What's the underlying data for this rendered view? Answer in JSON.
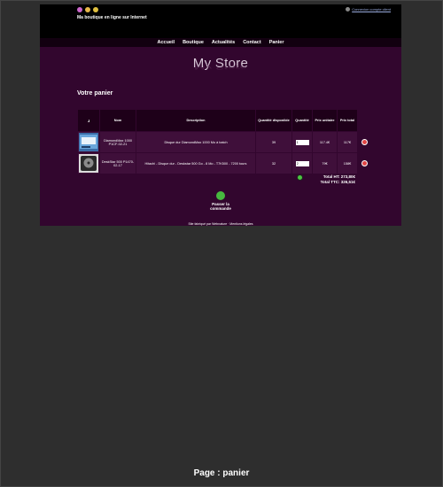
{
  "header": {
    "tagline": "Ma boutique en ligne sur Internet",
    "login_link": "Connexion compte client",
    "flags": [
      "#cc66cc",
      "#e8b84a",
      "#e0c040"
    ]
  },
  "nav": [
    "Accueil",
    "Boutique",
    "Actualités",
    "Contact",
    "Panier"
  ],
  "logo": "My Store",
  "cart": {
    "title": "Votre panier",
    "columns": [
      "Nom",
      "Description",
      "Quantité disponible",
      "Quantité",
      "Prix unitaire",
      "Prix total"
    ],
    "rows": [
      {
        "name": "DiamondMax 1000 P1CF-02-21",
        "description": "Disque dur DiamondMax 1000 Mo à batch",
        "stock": "39",
        "qty": "1",
        "unit_price": "117.4€",
        "total": "117€"
      },
      {
        "name": "DeskStar 500 P1470-02-17",
        "description": "Hitachi - Disque dur - Deskstar 500 Go - 8 Mo - T7K500 - 7200 tours",
        "stock": "32",
        "qty": "2",
        "unit_price": "79€",
        "total": "158€"
      }
    ],
    "total_ht": "Total HT: 273,80€",
    "total_ttc": "Total TTC: 326,51€",
    "order_label": "Passer la commande"
  },
  "footer": "Site fabriqué par Webnature · Mentions légales",
  "caption": "Page : panier",
  "colors": {
    "page_bg": "#2e2e2e",
    "site_bg": "#32062e",
    "header_bg": "#000000",
    "row_bg": "#3f0f3a",
    "delete": "#e04444",
    "action": "#47b83f"
  }
}
